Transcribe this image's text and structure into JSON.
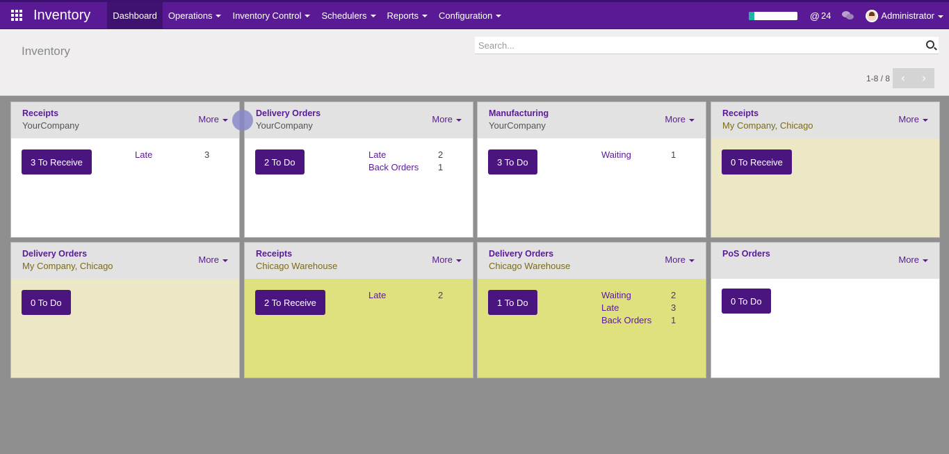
{
  "app": {
    "title": "Inventory",
    "menu": [
      {
        "label": "Dashboard",
        "active": true
      },
      {
        "label": "Operations"
      },
      {
        "label": "Inventory Control"
      },
      {
        "label": "Schedulers"
      },
      {
        "label": "Reports"
      },
      {
        "label": "Configuration"
      }
    ],
    "progress": 0.12,
    "message_count": "24",
    "user": "Administrator"
  },
  "control": {
    "page_title": "Inventory",
    "search_placeholder": "Search...",
    "pager": "1-8 / 8"
  },
  "cards": [
    {
      "title": "Receipts",
      "sub": "YourCompany",
      "more": "More",
      "button": "3 To Receive",
      "tone": "white",
      "stats": [
        {
          "label": "Late",
          "value": "3"
        }
      ]
    },
    {
      "title": "Delivery Orders",
      "sub": "YourCompany",
      "more": "More",
      "button": "2 To Do",
      "tone": "white",
      "stats": [
        {
          "label": "Late",
          "value": "2"
        },
        {
          "label": "Back Orders",
          "value": "1"
        }
      ]
    },
    {
      "title": "Manufacturing",
      "sub": "YourCompany",
      "more": "More",
      "button": "3 To Do",
      "tone": "white",
      "stats": [
        {
          "label": "Waiting",
          "value": "1"
        }
      ]
    },
    {
      "title": "Receipts",
      "sub": "My Company, Chicago",
      "more": "More",
      "button": "0 To Receive",
      "tone": "pale",
      "stats": []
    },
    {
      "title": "Delivery Orders",
      "sub": "My Company, Chicago",
      "more": "More",
      "button": "0 To Do",
      "tone": "pale",
      "stats": []
    },
    {
      "title": "Receipts",
      "sub": "Chicago Warehouse",
      "more": "More",
      "button": "2 To Receive",
      "tone": "yellow",
      "stats": [
        {
          "label": "Late",
          "value": "2"
        }
      ]
    },
    {
      "title": "Delivery Orders",
      "sub": "Chicago Warehouse",
      "more": "More",
      "button": "1 To Do",
      "tone": "yellow",
      "stats": [
        {
          "label": "Waiting",
          "value": "2"
        },
        {
          "label": "Late",
          "value": "3"
        },
        {
          "label": "Back Orders",
          "value": "1"
        }
      ]
    },
    {
      "title": "PoS Orders",
      "sub": "",
      "more": "More",
      "button": "0 To Do",
      "tone": "white",
      "stats": []
    }
  ]
}
